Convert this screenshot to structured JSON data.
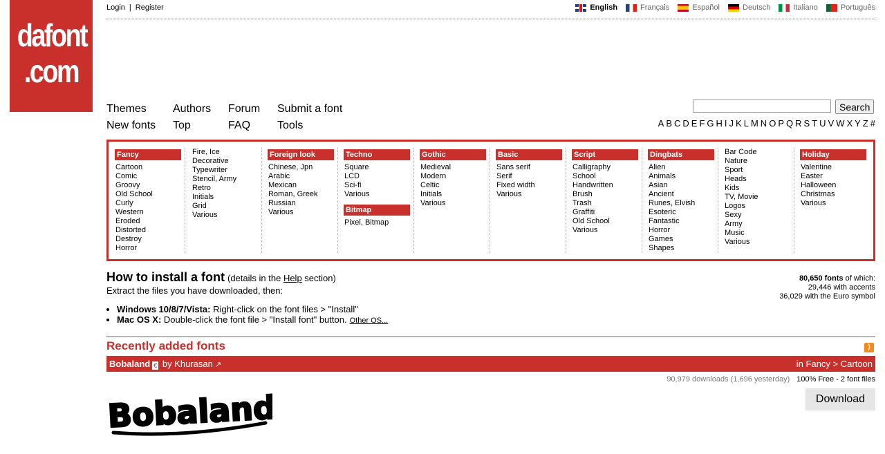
{
  "logo": {
    "line1": "dafont",
    "line2": ".com"
  },
  "auth": {
    "login": "Login",
    "sep": "|",
    "register": "Register"
  },
  "languages": [
    {
      "label": "English",
      "flag": "flag-en",
      "active": true
    },
    {
      "label": "Français",
      "flag": "flag-fr",
      "active": false
    },
    {
      "label": "Español",
      "flag": "flag-es",
      "active": false
    },
    {
      "label": "Deutsch",
      "flag": "flag-de",
      "active": false
    },
    {
      "label": "Italiano",
      "flag": "flag-it",
      "active": false
    },
    {
      "label": "Português",
      "flag": "flag-pt",
      "active": false
    }
  ],
  "nav": {
    "themes": "Themes",
    "new_fonts": "New fonts",
    "authors": "Authors",
    "top": "Top",
    "forum": "Forum",
    "faq": "FAQ",
    "submit": "Submit a font",
    "tools": "Tools"
  },
  "search": {
    "value": "",
    "button": "Search"
  },
  "alphabet": [
    "A",
    "B",
    "C",
    "D",
    "E",
    "F",
    "G",
    "H",
    "I",
    "J",
    "K",
    "L",
    "M",
    "N",
    "O",
    "P",
    "Q",
    "R",
    "S",
    "T",
    "U",
    "V",
    "W",
    "X",
    "Y",
    "Z",
    "#"
  ],
  "categories": {
    "fancy": {
      "title": "Fancy",
      "items": [
        "Cartoon",
        "Comic",
        "Groovy",
        "Old School",
        "Curly",
        "Western",
        "Eroded",
        "Distorted",
        "Destroy",
        "Horror"
      ]
    },
    "fancy2": {
      "items": [
        "Fire, Ice",
        "Decorative",
        "Typewriter",
        "Stencil, Army",
        "Retro",
        "Initials",
        "Grid",
        "Various"
      ]
    },
    "foreign": {
      "title": "Foreign look",
      "items": [
        "Chinese, Jpn",
        "Arabic",
        "Mexican",
        "Roman, Greek",
        "Russian",
        "Various"
      ]
    },
    "techno": {
      "title": "Techno",
      "items": [
        "Square",
        "LCD",
        "Sci-fi",
        "Various"
      ]
    },
    "bitmap": {
      "title": "Bitmap",
      "items": [
        "Pixel, Bitmap"
      ]
    },
    "gothic": {
      "title": "Gothic",
      "items": [
        "Medieval",
        "Modern",
        "Celtic",
        "Initials",
        "Various"
      ]
    },
    "basic": {
      "title": "Basic",
      "items": [
        "Sans serif",
        "Serif",
        "Fixed width",
        "Various"
      ]
    },
    "script": {
      "title": "Script",
      "items": [
        "Calligraphy",
        "School",
        "Handwritten",
        "Brush",
        "Trash",
        "Graffiti",
        "Old School",
        "Various"
      ]
    },
    "dingbats": {
      "title": "Dingbats",
      "items": [
        "Alien",
        "Animals",
        "Asian",
        "Ancient",
        "Runes, Elvish",
        "Esoteric",
        "Fantastic",
        "Horror",
        "Games",
        "Shapes"
      ]
    },
    "dingbats2": {
      "items": [
        "Bar Code",
        "Nature",
        "Sport",
        "Heads",
        "Kids",
        "TV, Movie",
        "Logos",
        "Sexy",
        "Army",
        "Music",
        "Various"
      ]
    },
    "holiday": {
      "title": "Holiday",
      "items": [
        "Valentine",
        "Easter",
        "Halloween",
        "Christmas",
        "Various"
      ]
    }
  },
  "install": {
    "title": "How to install a font",
    "details_pre": "(details in the ",
    "details_link": "Help",
    "details_post": " section)",
    "extract": "Extract the files you have downloaded, then:",
    "win_label": "Windows 10/8/7/Vista:",
    "win_text": " Right-click on the font files > \"Install\"",
    "mac_label": "Mac OS X:",
    "mac_text": " Double-click the font file > \"Install font\" button.",
    "other": "Other OS..."
  },
  "stats": {
    "total": "80,650 fonts",
    "total_suffix": " of which:",
    "accents": "29,446 with accents",
    "euro": "36,029 with the Euro symbol"
  },
  "recent": {
    "title": "Recently added fonts"
  },
  "font": {
    "name": "Bobaland",
    "badge": "€",
    "by": " by ",
    "author": "Khurasan",
    "category": "in Fancy > Cartoon",
    "downloads": "90,979 downloads (1,696 yesterday)",
    "license": "100% Free - 2 font files",
    "download_button": "Download",
    "preview_text": "Bobaland!"
  }
}
